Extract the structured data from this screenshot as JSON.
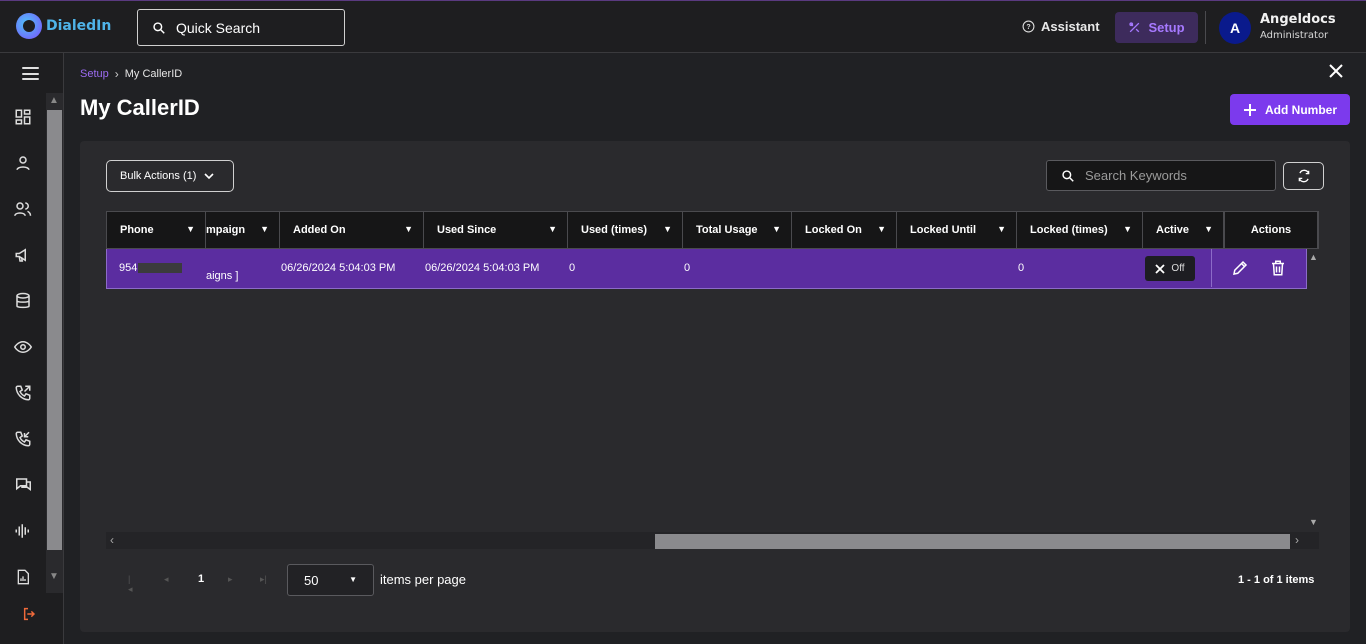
{
  "app": {
    "brand": "DialedIn"
  },
  "header": {
    "search_label": "Quick Search",
    "assistant_label": "Assistant",
    "setup_label": "Setup",
    "user_initial": "A",
    "user_name": "Angeldocs",
    "user_role": "Administrator"
  },
  "sidebar": {
    "icons": [
      "dashboard-icon",
      "user-icon",
      "users-icon",
      "megaphone-icon",
      "database-icon",
      "eye-icon",
      "outbound-call-icon",
      "inbound-call-icon",
      "chat-icon",
      "audio-wave-icon",
      "report-icon",
      "logout-icon"
    ]
  },
  "breadcrumb": {
    "parent": "Setup",
    "current": "My CallerID"
  },
  "page": {
    "title": "My CallerID",
    "add_button": "Add Number"
  },
  "toolbar": {
    "bulk_actions": "Bulk Actions (1)",
    "search_placeholder": "Search Keywords"
  },
  "table": {
    "columns": [
      "Phone",
      "mpaign",
      "Added On",
      "Used Since",
      "Used (times)",
      "Total Usage",
      "Locked On",
      "Locked Until",
      "Locked (times)",
      "Active",
      "Actions"
    ],
    "rows": [
      {
        "phone": "954",
        "campaign": "aigns ]",
        "added_on": "06/26/2024 5:04:03 PM",
        "used_since": "06/26/2024 5:04:03 PM",
        "used_times": "0",
        "total_usage": "0",
        "locked_on": "",
        "locked_until": "",
        "locked_times": "0",
        "active": "Off"
      }
    ]
  },
  "pager": {
    "page": "1",
    "per_page": "50",
    "per_page_label": "items per page",
    "range": "1 - 1 of 1 items"
  },
  "colors": {
    "accent": "#7c3aed",
    "row_selected": "#5b2da0",
    "link": "#9c6cf2"
  }
}
